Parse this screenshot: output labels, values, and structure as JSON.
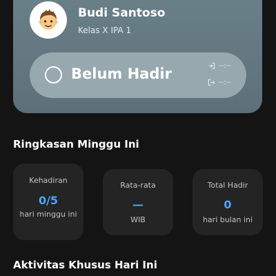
{
  "profile": {
    "name": "Budi Santoso",
    "class": "Kelas X IPA 1",
    "avatar_icon": "boy-face-icon"
  },
  "attendance": {
    "status": "Belum Hadir",
    "check_in_time": "--:--",
    "check_out_time": "--:--",
    "check_in_icon": "login-icon",
    "check_out_icon": "logout-icon"
  },
  "weekly_summary": {
    "title": "Ringkasan Minggu Ini",
    "cards": [
      {
        "label": "Kehadiran",
        "value": "0/5",
        "sub": "hari minggu ini"
      },
      {
        "label": "Rata-rata",
        "value": "—",
        "sub": "WIB"
      },
      {
        "label": "Total Hadir",
        "value": "0",
        "sub": "hari bulan ini"
      }
    ]
  },
  "special_activities": {
    "title": "Aktivitas Khusus Hari Ini"
  },
  "colors": {
    "background": "#141414",
    "card": "#242424",
    "accent": "#4fa3ff",
    "profile_card": "#64787f"
  }
}
